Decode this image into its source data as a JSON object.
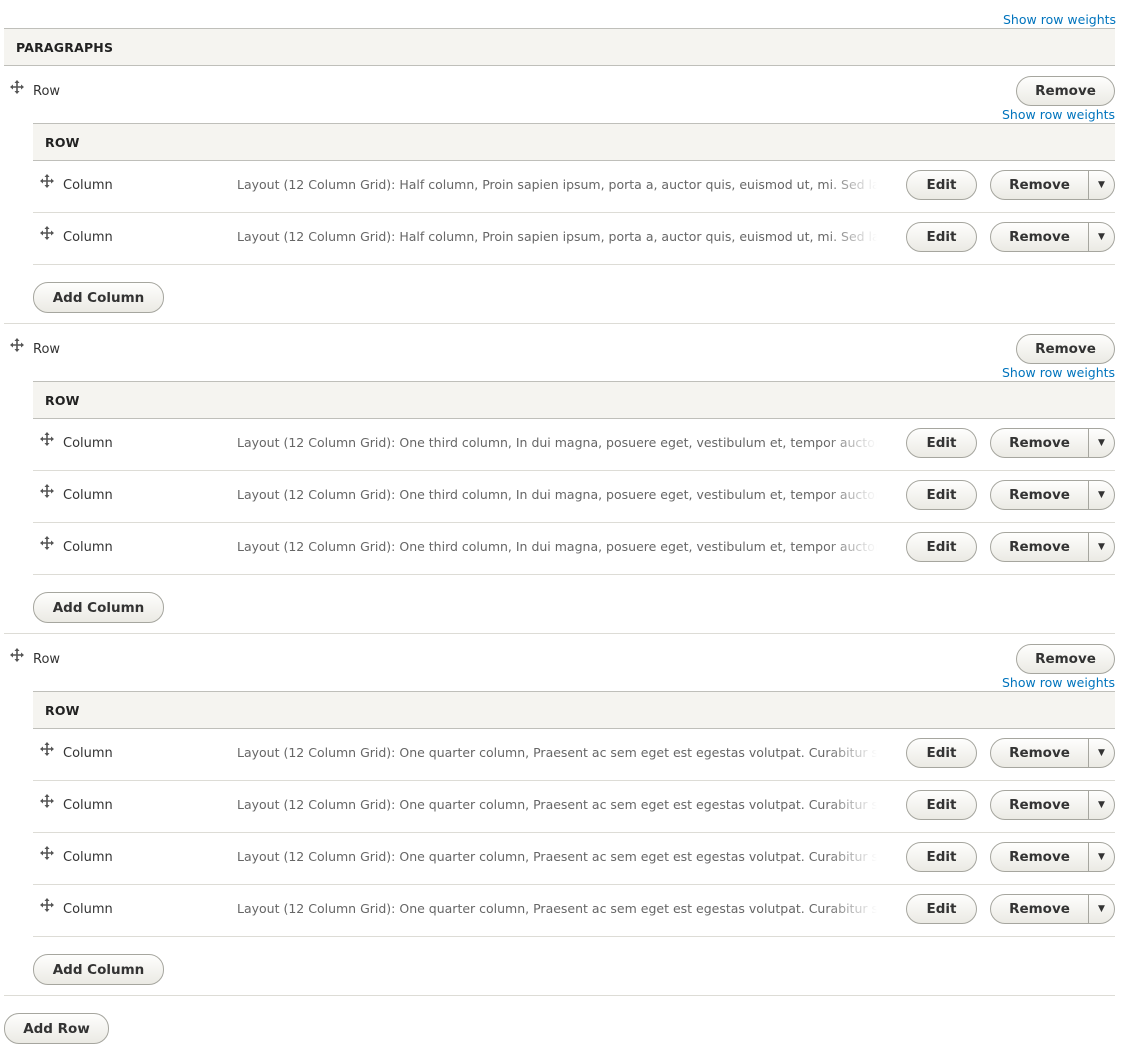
{
  "show_row_weights": "Show row weights",
  "section_header": "PARAGRAPHS",
  "row_header": "ROW",
  "row_label": "Row",
  "column_label": "Column",
  "buttons": {
    "remove": "Remove",
    "edit": "Edit",
    "add_column": "Add Column",
    "add_row": "Add Row",
    "dropdown_arrow": "▼"
  },
  "icons": {
    "drag": "move-handle-icon",
    "dropdown": "chevron-down-icon"
  },
  "colors": {
    "link": "#0074bd",
    "header_bg": "#f5f4f0",
    "border": "#bfbfba"
  },
  "rows": [
    {
      "columns": [
        {
          "summary": "Layout (12 Column Grid): Half column, Proin sapien ipsum, porta a, auctor quis, euismod ut, mi. Sed lacinia"
        },
        {
          "summary": "Layout (12 Column Grid): Half column, Proin sapien ipsum, porta a, auctor quis, euismod ut, mi. Sed lacinia"
        }
      ]
    },
    {
      "columns": [
        {
          "summary": "Layout (12 Column Grid): One third column, In dui magna, posuere eget, vestibulum et, tempor auctor"
        },
        {
          "summary": "Layout (12 Column Grid): One third column, In dui magna, posuere eget, vestibulum et, tempor auctor"
        },
        {
          "summary": "Layout (12 Column Grid): One third column, In dui magna, posuere eget, vestibulum et, tempor auctor"
        }
      ]
    },
    {
      "columns": [
        {
          "summary": "Layout (12 Column Grid): One quarter column, Praesent ac sem eget est egestas volutpat. Curabitur suscipit"
        },
        {
          "summary": "Layout (12 Column Grid): One quarter column, Praesent ac sem eget est egestas volutpat. Curabitur suscipit"
        },
        {
          "summary": "Layout (12 Column Grid): One quarter column, Praesent ac sem eget est egestas volutpat. Curabitur suscipit"
        },
        {
          "summary": "Layout (12 Column Grid): One quarter column, Praesent ac sem eget est egestas volutpat. Curabitur suscipit"
        }
      ]
    }
  ]
}
